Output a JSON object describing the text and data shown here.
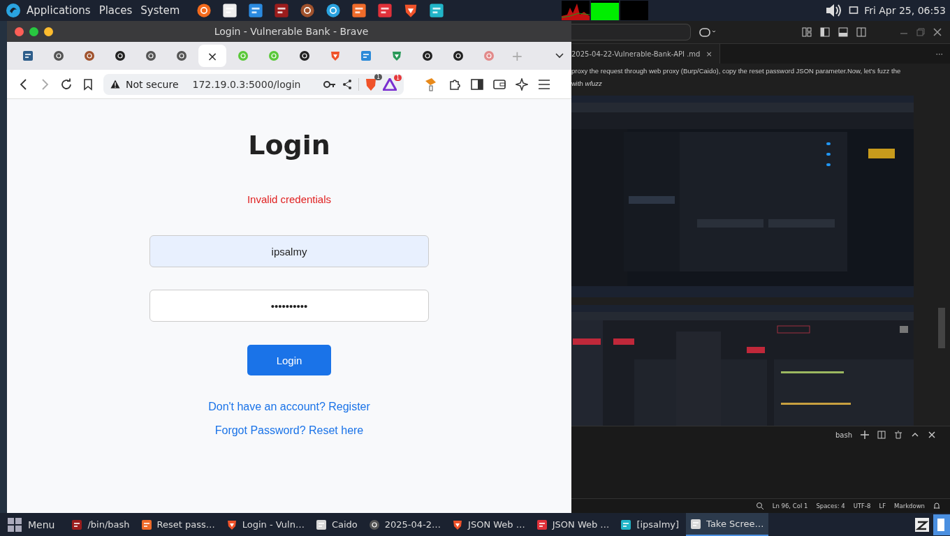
{
  "top_panel": {
    "menus": [
      "Applications",
      "Places",
      "System"
    ],
    "launchers": [
      {
        "kind": "fox"
      },
      {
        "kind": "doc"
      },
      {
        "kind": "code"
      },
      {
        "kind": "term"
      },
      {
        "kind": "swirl"
      },
      {
        "kind": "plane"
      },
      {
        "kind": "pen"
      },
      {
        "kind": "vee"
      },
      {
        "kind": "lion"
      },
      {
        "kind": "folder"
      }
    ],
    "clock": "Fri Apr 25, 06:53"
  },
  "browser": {
    "title": "Login - Vulnerable Bank - Brave",
    "tabs": [
      {
        "kind": "bank",
        "selected": false
      },
      {
        "kind": "globe",
        "selected": false
      },
      {
        "kind": "swirl",
        "selected": false
      },
      {
        "kind": "cat",
        "selected": false
      },
      {
        "kind": "globe",
        "selected": false
      },
      {
        "kind": "globe",
        "selected": false
      },
      {
        "selected": true,
        "close": "×"
      },
      {
        "kind": "green",
        "selected": false
      },
      {
        "kind": "green",
        "selected": false
      },
      {
        "kind": "cat",
        "selected": false
      },
      {
        "kind": "lion",
        "selected": false
      },
      {
        "kind": "square",
        "selected": false
      },
      {
        "kind": "mountain",
        "selected": false
      },
      {
        "kind": "cat",
        "selected": false
      },
      {
        "kind": "cat",
        "selected": false
      },
      {
        "kind": "pink",
        "selected": false
      }
    ],
    "new_tab": "+",
    "security": "Not secure",
    "url": "172.19.0.3:5000/login",
    "shield_count": "1",
    "rewards_count": "1",
    "page": {
      "heading": "Login",
      "error": "Invalid credentials",
      "username": "ipsalmy",
      "password": "••••••••••",
      "button": "Login",
      "links": [
        "Don't have an account? Register",
        "Forgot Password? Reset here"
      ]
    }
  },
  "editor": {
    "tab": "2025-04-22-Vulnerable-Bank-API .md",
    "tab_close": "×",
    "more": "···",
    "lines": [
      "proxy the request through web proxy (Burp/Caido), copy the reset password JSON parameter.Now, let's fuzz the",
      "with *wfuzz*"
    ],
    "images": [
      {
        "kind": "picture"
      },
      {
        "kind": "picture"
      }
    ],
    "terminal": {
      "shell": "bash"
    },
    "status": [
      "Ln 96, Col 1",
      "Spaces: 4",
      "UTF-8",
      "LF",
      "Markdown"
    ]
  },
  "taskbar": {
    "menu": "Menu",
    "items": [
      {
        "kind": "term",
        "label": "/bin/bash",
        "selected": false
      },
      {
        "kind": "pen",
        "label": "Reset pass…",
        "selected": false
      },
      {
        "kind": "lion",
        "label": "Login - Vuln…",
        "selected": false
      },
      {
        "kind": "window",
        "label": "Caido",
        "selected": false
      },
      {
        "kind": "globe",
        "label": "2025-04-2…",
        "selected": false
      },
      {
        "kind": "lion",
        "label": "JSON Web …",
        "selected": false
      },
      {
        "kind": "vee",
        "label": "JSON Web …",
        "selected": false
      },
      {
        "kind": "folder",
        "label": "[ipsalmy]",
        "selected": false
      },
      {
        "kind": "window",
        "label": "Take Scree…",
        "selected": true
      }
    ]
  }
}
